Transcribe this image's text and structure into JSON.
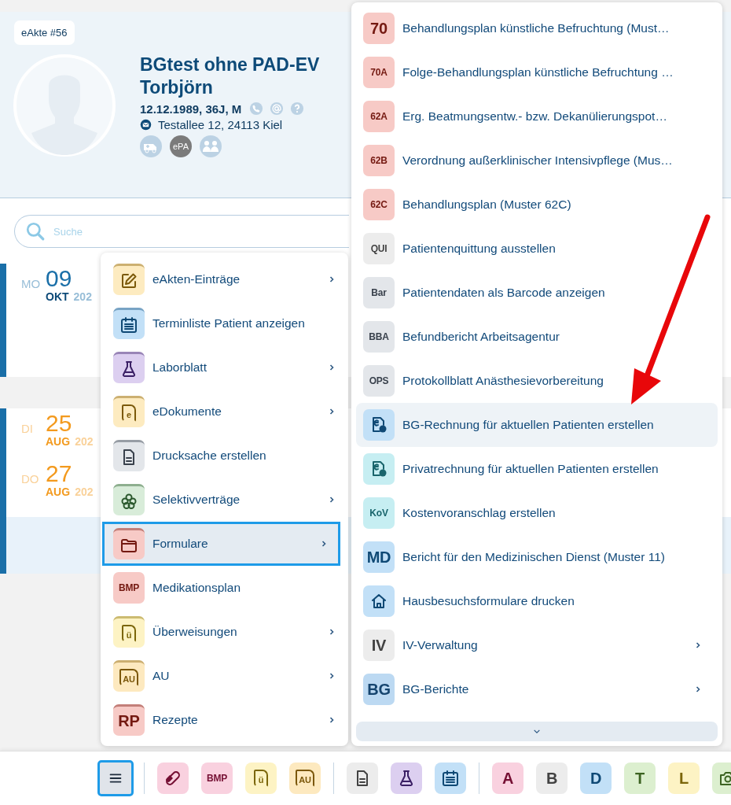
{
  "patient": {
    "record_badge": "eAkte #56",
    "name_line_1": "BGtest ohne PAD-EV",
    "name_line_2": "Torbjörn",
    "birth_info": "12.12.1989, 36J, M",
    "address": "Testallee 12, 24113 Kiel",
    "epa_label": "ePA"
  },
  "search": {
    "placeholder": "Suche"
  },
  "timeline": [
    {
      "color": "#1a6fa8",
      "entries": [
        {
          "weekday": "MO",
          "day": "09",
          "month": "OKT",
          "year": "202"
        }
      ]
    },
    {
      "color": "#f39a1e",
      "entries": [
        {
          "weekday": "DI",
          "day": "25",
          "month": "AUG",
          "year": "202"
        },
        {
          "weekday": "DO",
          "day": "27",
          "month": "AUG",
          "year": "202"
        }
      ]
    }
  ],
  "menu": {
    "items": [
      {
        "label": "eAkten-Einträge",
        "kind": "edit",
        "color": "#fdebc0",
        "has_submenu": true,
        "selected": false
      },
      {
        "label": "Terminliste Patient anzeigen",
        "kind": "calendar",
        "color": "#c2e0f7",
        "has_submenu": false,
        "selected": false
      },
      {
        "label": "Laborblatt",
        "kind": "flask",
        "color": "#dccff0",
        "has_submenu": true,
        "selected": false
      },
      {
        "label": "eDokumente",
        "kind": "doc-letter",
        "icon_text": "e",
        "color": "#fdebc0",
        "has_submenu": true,
        "selected": false
      },
      {
        "label": "Drucksache erstellen",
        "kind": "document",
        "color": "#e3e6ea",
        "has_submenu": false,
        "selected": false
      },
      {
        "label": "Selektivverträge",
        "kind": "flower",
        "color": "#d8ecd9",
        "has_submenu": true,
        "selected": false
      },
      {
        "label": "Formulare",
        "kind": "folder",
        "color": "#f7cac6",
        "has_submenu": true,
        "selected": true
      },
      {
        "label": "Medikationsplan",
        "kind": "code",
        "icon_text": "BMP",
        "color": "#f7cac6",
        "has_submenu": false,
        "selected": false
      },
      {
        "label": "Überweisungen",
        "kind": "doc-letter",
        "icon_text": "ü",
        "color": "#fdf3c4",
        "has_submenu": true,
        "selected": false
      },
      {
        "label": "AU",
        "kind": "doc-letter",
        "icon_text": "AU",
        "color": "#fde9bf",
        "has_submenu": true,
        "selected": false
      },
      {
        "label": "Rezepte",
        "kind": "code",
        "icon_text": "RP",
        "color": "#f7cac6",
        "has_submenu": true,
        "selected": false
      }
    ]
  },
  "submenu": {
    "items": [
      {
        "label": "Behandlungsplan künstliche Befruchtung (Must…",
        "kind": "code",
        "icon_text": "70",
        "color": "#f7cac6",
        "has_submenu": false,
        "highlighted": false
      },
      {
        "label": "Folge-Behandlungsplan künstliche Befruchtung …",
        "kind": "code",
        "icon_text": "70A",
        "color": "#f7cac6",
        "has_submenu": false,
        "highlighted": false
      },
      {
        "label": "Erg. Beatmungsentw.- bzw. Dekanülierungspot…",
        "kind": "code",
        "icon_text": "62A",
        "color": "#f7cac6",
        "has_submenu": false,
        "highlighted": false
      },
      {
        "label": "Verordnung außerklinischer Intensivpflege (Mus…",
        "kind": "code",
        "icon_text": "62B",
        "color": "#f7cac6",
        "has_submenu": false,
        "highlighted": false
      },
      {
        "label": "Behandlungsplan (Muster 62C)",
        "kind": "code",
        "icon_text": "62C",
        "color": "#f7cac6",
        "has_submenu": false,
        "highlighted": false
      },
      {
        "label": "Patientenquittung ausstellen",
        "kind": "code",
        "icon_text": "QUI",
        "color": "#ececec",
        "has_submenu": false,
        "highlighted": false
      },
      {
        "label": "Patientendaten als Barcode anzeigen",
        "kind": "code",
        "icon_text": "Bar",
        "color": "#e3e6ea",
        "has_submenu": false,
        "highlighted": false
      },
      {
        "label": "Befundbericht Arbeitsagentur",
        "kind": "code",
        "icon_text": "BBA",
        "color": "#e3e6ea",
        "has_submenu": false,
        "highlighted": false
      },
      {
        "label": "Protokollblatt Anästhesievorbereitung",
        "kind": "code",
        "icon_text": "OPS",
        "color": "#e3e6ea",
        "has_submenu": false,
        "highlighted": false
      },
      {
        "label": "BG-Rechnung für aktuellen Patienten erstellen",
        "kind": "invoice",
        "color": "#c2e0f7",
        "has_submenu": false,
        "highlighted": true
      },
      {
        "label": "Privatrechnung für aktuellen Patienten erstellen",
        "kind": "invoice",
        "color": "#c6eef2",
        "has_submenu": false,
        "highlighted": false
      },
      {
        "label": "Kostenvoranschlag erstellen",
        "kind": "code",
        "icon_text": "KoV",
        "color": "#c6eef2",
        "has_submenu": false,
        "highlighted": false
      },
      {
        "label": "Bericht für den Medizinischen Dienst (Muster 11)",
        "kind": "code",
        "icon_text": "MD",
        "color": "#c2e0f7",
        "has_submenu": false,
        "highlighted": false
      },
      {
        "label": "Hausbesuchsformulare drucken",
        "kind": "house",
        "color": "#c2e0f7",
        "has_submenu": false,
        "highlighted": false
      },
      {
        "label": "IV-Verwaltung",
        "kind": "code",
        "icon_text": "IV",
        "color": "#ececec",
        "has_submenu": true,
        "highlighted": false
      },
      {
        "label": "BG-Berichte",
        "kind": "code",
        "icon_text": "BG",
        "color": "#bcd9f2",
        "has_submenu": true,
        "highlighted": false
      }
    ]
  },
  "toolbar": [
    {
      "kind": "menu",
      "selected": true
    },
    {
      "kind": "separator"
    },
    {
      "kind": "pill",
      "color": "#f9d1df"
    },
    {
      "kind": "code",
      "text": "BMP",
      "color": "#f9d1df"
    },
    {
      "kind": "doc-letter",
      "text": "ü",
      "color": "#fdf3c4"
    },
    {
      "kind": "doc-letter",
      "text": "AU",
      "color": "#fde9bf"
    },
    {
      "kind": "separator"
    },
    {
      "kind": "document",
      "color": "#ececec"
    },
    {
      "kind": "flask",
      "color": "#dccff0"
    },
    {
      "kind": "calendar",
      "color": "#c2e0f7"
    },
    {
      "kind": "separator"
    },
    {
      "kind": "code",
      "text": "A",
      "color": "#f9d1df"
    },
    {
      "kind": "code",
      "text": "B",
      "color": "#ececec"
    },
    {
      "kind": "code",
      "text": "D",
      "color": "#c2e0f7"
    },
    {
      "kind": "code",
      "text": "T",
      "color": "#dcefcf"
    },
    {
      "kind": "code",
      "text": "L",
      "color": "#fdf3c4"
    },
    {
      "kind": "camera",
      "color": "#dcefcf"
    }
  ]
}
